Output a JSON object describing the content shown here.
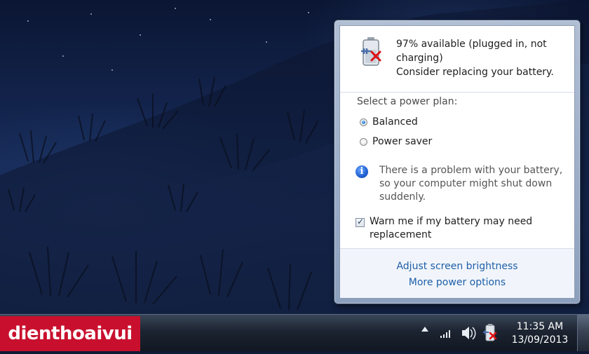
{
  "flyout": {
    "status_lines": [
      "97% available (plugged in, not",
      "charging)",
      "Consider replacing your battery."
    ],
    "plan_title": "Select a power plan:",
    "plans": [
      {
        "label": "Balanced",
        "selected": true
      },
      {
        "label": "Power saver",
        "selected": false
      }
    ],
    "warning_lines": [
      "There is a problem with your battery,",
      "so your computer might shut down",
      "suddenly."
    ],
    "warn_checkbox": {
      "lines": [
        "Warn me if my battery may need",
        "replacement"
      ],
      "checked": true
    },
    "links": {
      "brightness": "Adjust screen brightness",
      "more_options": "More power options"
    }
  },
  "taskbar": {
    "brand": "dienthoaivui",
    "time": "11:35 AM",
    "date": "13/09/2013",
    "tray_icons": [
      "show-hidden-icons",
      "network-signal-icon",
      "speaker-icon",
      "battery-icon"
    ]
  },
  "colors": {
    "link": "#1f5fa8",
    "brand_bg": "#c8102e",
    "battery_warning": "#e01010"
  }
}
